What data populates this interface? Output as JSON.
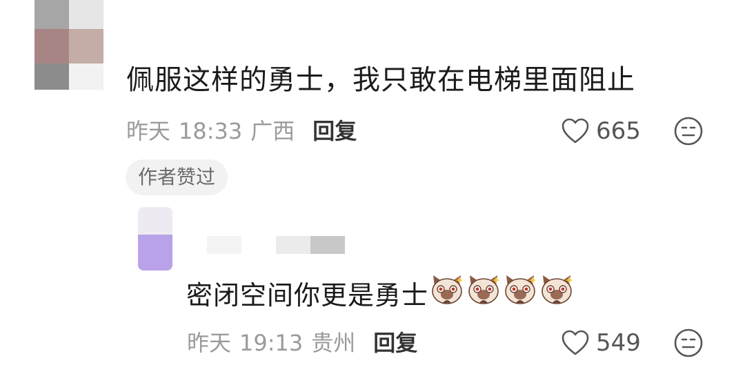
{
  "comment": {
    "text": "佩服这样的勇士，我只敢在电梯里面阻止",
    "date": "昨天",
    "time": "18:33",
    "location": "广西",
    "reply_label": "回复",
    "likes": "665",
    "author_tag": "作者赞过"
  },
  "reply": {
    "text": "密闭空间你更是勇士",
    "date": "昨天",
    "time": "19:13",
    "location": "贵州",
    "reply_label": "回复",
    "likes": "549",
    "sticker_count": 4
  },
  "icons": {
    "like": "heart-outline-icon",
    "emoji": "neutral-face-icon",
    "sticker": "cat-sticker-icon"
  },
  "colors": {
    "text_primary": "#1a1a1a",
    "text_meta": "#9a9a9a",
    "tag_bg": "#f2f2f2",
    "reply_button": "#333333"
  }
}
